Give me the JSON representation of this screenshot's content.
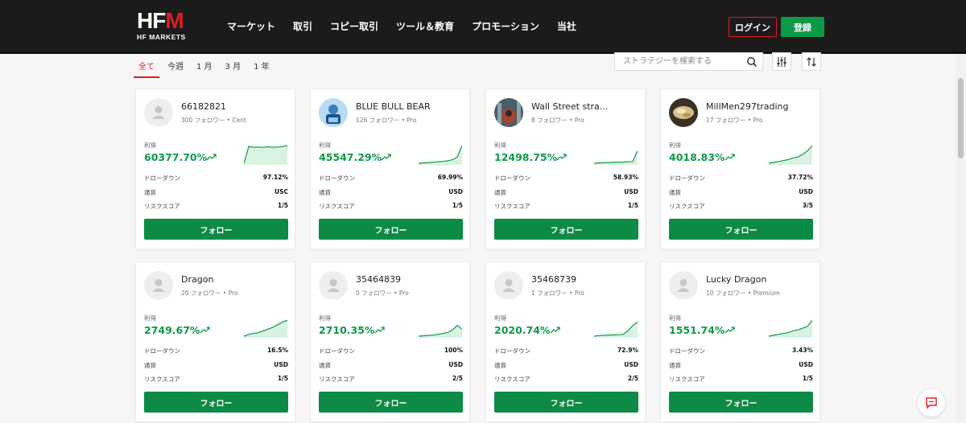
{
  "header": {
    "logo_mark": "HF",
    "logo_mark_accent": "M",
    "logo_sub": "HF MARKETS",
    "nav": [
      "マーケット",
      "取引",
      "コピー取引",
      "ツール＆教育",
      "プロモーション",
      "当社"
    ],
    "login": "ログイン",
    "register": "登録"
  },
  "filters": {
    "tabs": [
      "全て",
      "今週",
      "1 月",
      "3 月",
      "1 年"
    ],
    "active": 0
  },
  "search": {
    "placeholder": "ストラテジーを検索する"
  },
  "labels": {
    "profit": "利得",
    "drawdown": "ドローダウン",
    "currency": "通貨",
    "risk": "リスクスコア",
    "follow": "フォロー"
  },
  "colors": {
    "green": "#0d9a48",
    "red": "#e21b23",
    "header": "#1b1b1b"
  },
  "cards": [
    {
      "name": "66182821",
      "meta": "300 フォロワー • Cent",
      "profit": "60377.70%",
      "drawdown": "97.12%",
      "currency": "USC",
      "risk": "1/5",
      "avatar": "default",
      "spark": [
        0,
        0.95,
        0.9,
        0.92,
        0.9,
        0.93,
        0.9,
        0.92,
        0.94,
        1.0
      ]
    },
    {
      "name": "BLUE BULL BEAR",
      "meta": "126 フォロワー • Pro",
      "profit": "45547.29%",
      "drawdown": "69.99%",
      "currency": "USD",
      "risk": "1/5",
      "avatar": "bull",
      "spark": [
        0,
        0.02,
        0.04,
        0.06,
        0.08,
        0.1,
        0.14,
        0.2,
        0.35,
        1.0
      ]
    },
    {
      "name": "Wall Street stra...",
      "meta": "8 フォロワー • Pro",
      "profit": "12498.75%",
      "drawdown": "58.93%",
      "currency": "USD",
      "risk": "1/5",
      "avatar": "wall",
      "spark": [
        0,
        0.02,
        0.03,
        0.04,
        0.05,
        0.06,
        0.07,
        0.08,
        0.1,
        0.7
      ]
    },
    {
      "name": "MillMen297trading",
      "meta": "17 フォロワー • Pro",
      "profit": "4018.83%",
      "drawdown": "37.72%",
      "currency": "USD",
      "risk": "3/5",
      "avatar": "gold",
      "spark": [
        0,
        0.05,
        0.1,
        0.15,
        0.2,
        0.3,
        0.35,
        0.5,
        0.7,
        1.0
      ]
    },
    {
      "name": "Dragon",
      "meta": "20 フォロワー • Pro",
      "profit": "2749.67%",
      "drawdown": "16.5%",
      "currency": "USD",
      "risk": "1/5",
      "avatar": "default",
      "spark": [
        0,
        0.1,
        0.15,
        0.2,
        0.3,
        0.4,
        0.5,
        0.65,
        0.8,
        0.9
      ]
    },
    {
      "name": "35464839",
      "meta": "0 フォロワー • Pro",
      "profit": "2710.35%",
      "drawdown": "100%",
      "currency": "USD",
      "risk": "2/5",
      "avatar": "default",
      "spark": [
        0,
        0.02,
        0.04,
        0.06,
        0.1,
        0.15,
        0.2,
        0.35,
        0.6,
        0.4
      ]
    },
    {
      "name": "35468739",
      "meta": "1 フォロワー • Pro",
      "profit": "2020.74%",
      "drawdown": "72.9%",
      "currency": "USD",
      "risk": "2/5",
      "avatar": "default",
      "spark": [
        0,
        0.03,
        0.05,
        0.06,
        0.07,
        0.08,
        0.1,
        0.3,
        0.6,
        0.8
      ]
    },
    {
      "name": "Lucky Dragon",
      "meta": "10 フォロワー • Premium",
      "profit": "1551.74%",
      "drawdown": "3.43%",
      "currency": "USD",
      "risk": "1/5",
      "avatar": "default",
      "spark": [
        0,
        0.05,
        0.1,
        0.15,
        0.2,
        0.3,
        0.35,
        0.45,
        0.55,
        0.9
      ]
    }
  ]
}
